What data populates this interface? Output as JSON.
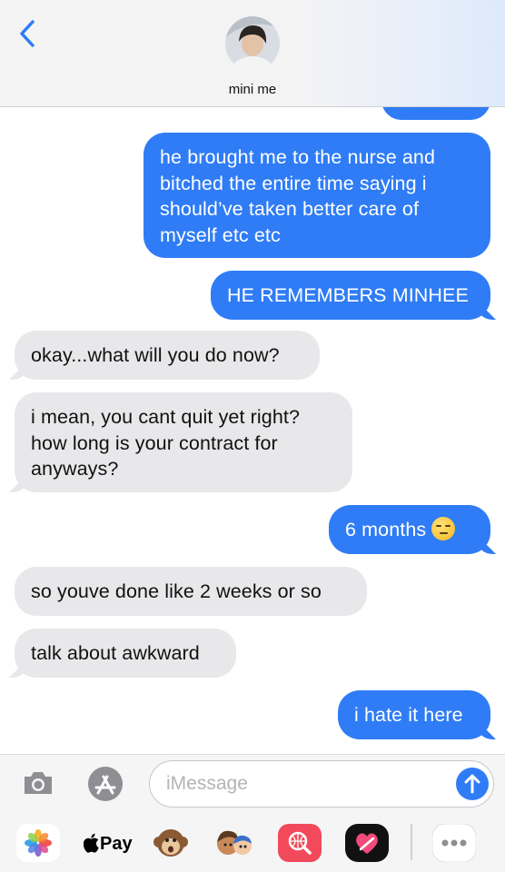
{
  "header": {
    "contact_name": "mini me"
  },
  "messages": [
    {
      "side": "sent",
      "text": "he brought me to the nurse and bitched the entire time saying i should’ve taken better care of myself etc etc"
    },
    {
      "side": "sent",
      "text": "HE REMEMBERS MINHEE"
    },
    {
      "side": "received",
      "text": "okay...what will you do now?"
    },
    {
      "side": "received",
      "text": "i mean, you cant quit yet right? how long is your contract for anyways?"
    },
    {
      "side": "sent",
      "text": "6 months",
      "emoji": "unamused-face"
    },
    {
      "side": "received",
      "text": "so youve done like 2 weeks or so"
    },
    {
      "side": "received",
      "text": "talk about awkward"
    },
    {
      "side": "sent",
      "text": "i hate it here"
    }
  ],
  "composer": {
    "placeholder": "iMessage",
    "apple_pay_label": "Pay"
  },
  "app_drawer": [
    "photos-icon",
    "apple-pay-icon",
    "memoji-monkey-icon",
    "memoji-stickers-icon",
    "web-images-search-icon",
    "digital-touch-icon",
    "more-apps-icon"
  ],
  "colors": {
    "sent_bubble": "#2f7cf6",
    "received_bubble": "#e8e8ea",
    "accent": "#2f7cf6"
  }
}
